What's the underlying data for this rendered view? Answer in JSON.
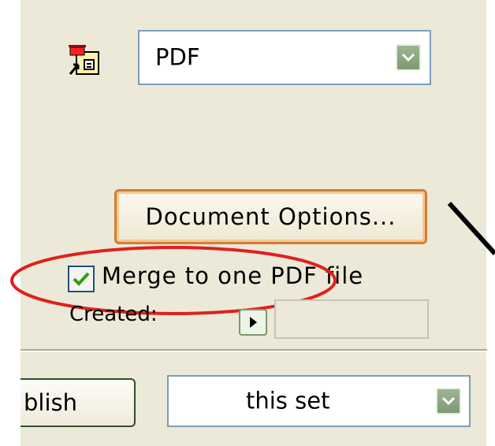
{
  "format_select": {
    "value": "PDF",
    "icon": "publish-format-icon"
  },
  "document_options_button": {
    "label": "Document Options..."
  },
  "merge_checkbox": {
    "label": "Merge to one PDF file",
    "checked": true,
    "annotation_color": "#e0201e"
  },
  "created": {
    "label": "Created:",
    "value": ""
  },
  "publish_button": {
    "label": "blish"
  },
  "set_select": {
    "value": "this set"
  },
  "colors": {
    "panel_bg": "#ece9d8",
    "button_border_hot": "#d07f36",
    "combo_border": "#7f9db9",
    "check_color": "#2ea10e"
  }
}
